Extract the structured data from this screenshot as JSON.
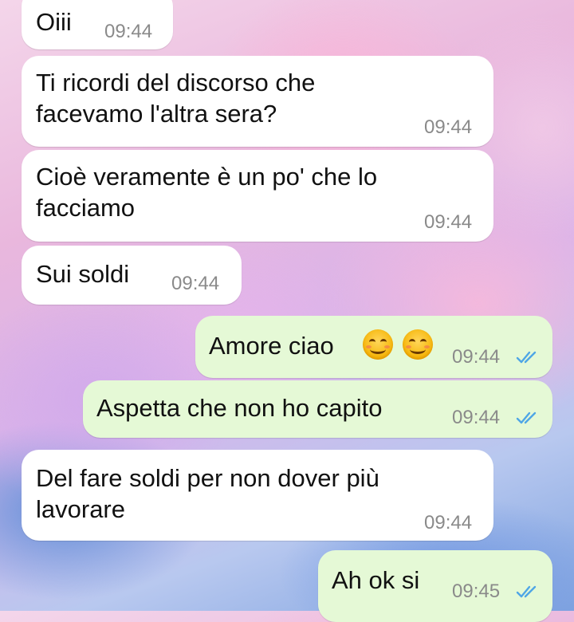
{
  "messages": [
    {
      "direction": "incoming",
      "text": "Oiii",
      "time": "09:44"
    },
    {
      "direction": "incoming",
      "text": "Ti ricordi del discorso che\nfacevamo l'altra sera?",
      "time": "09:44"
    },
    {
      "direction": "incoming",
      "text": "Cioè veramente è un po' che lo\nfacciamo",
      "time": "09:44"
    },
    {
      "direction": "incoming",
      "text": "Sui soldi",
      "time": "09:44"
    },
    {
      "direction": "outgoing",
      "text": "Amore ciao",
      "emoji": [
        "smiling-face-icon",
        "smiling-face-icon"
      ],
      "time": "09:44",
      "status": "read"
    },
    {
      "direction": "outgoing",
      "text": "Aspetta che non ho capito",
      "time": "09:44",
      "status": "read"
    },
    {
      "direction": "incoming",
      "text": "Del fare soldi per non dover più\nlavorare",
      "time": "09:44"
    },
    {
      "direction": "outgoing",
      "text": "Ah ok si",
      "time": "09:45",
      "status": "read"
    }
  ],
  "colors": {
    "incoming_bubble": "#ffffff",
    "outgoing_bubble": "#e5f9d6",
    "timestamp": "#8a8a8a",
    "read_ticks": "#4fa6e6"
  }
}
